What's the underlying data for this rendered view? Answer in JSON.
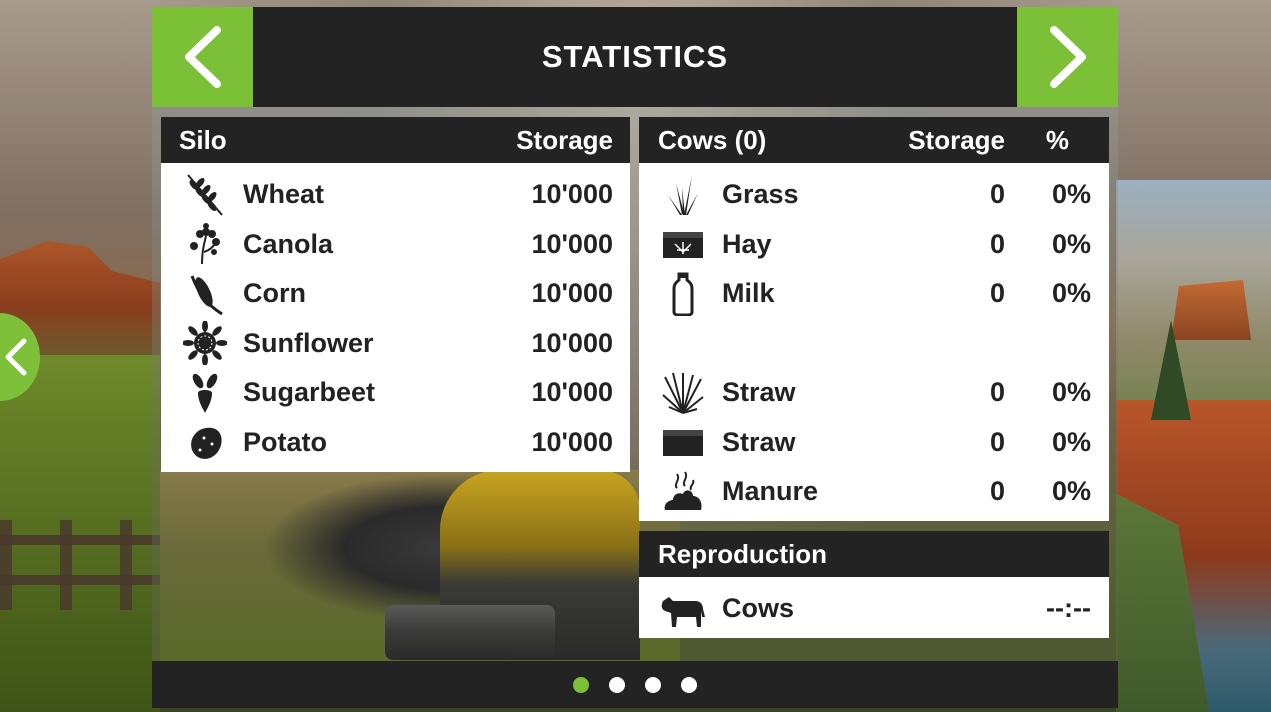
{
  "header": {
    "title": "STATISTICS"
  },
  "silo": {
    "headers": {
      "name": "Silo",
      "storage": "Storage"
    },
    "rows": [
      {
        "icon": "wheat-icon",
        "name": "Wheat",
        "storage": "10'000"
      },
      {
        "icon": "canola-icon",
        "name": "Canola",
        "storage": "10'000"
      },
      {
        "icon": "corn-icon",
        "name": "Corn",
        "storage": "10'000"
      },
      {
        "icon": "sunflower-icon",
        "name": "Sunflower",
        "storage": "10'000"
      },
      {
        "icon": "sugarbeet-icon",
        "name": "Sugarbeet",
        "storage": "10'000"
      },
      {
        "icon": "potato-icon",
        "name": "Potato",
        "storage": "10'000"
      }
    ]
  },
  "cows": {
    "headers": {
      "name": "Cows (0)",
      "storage": "Storage",
      "percent": "%"
    },
    "rows": [
      {
        "icon": "grass-icon",
        "name": "Grass",
        "storage": "0",
        "percent": "0%"
      },
      {
        "icon": "hay-icon",
        "name": "Hay",
        "storage": "0",
        "percent": "0%"
      },
      {
        "icon": "milk-icon",
        "name": "Milk",
        "storage": "0",
        "percent": "0%"
      },
      {
        "icon": "straw-icon",
        "name": "Straw",
        "storage": "0",
        "percent": "0%"
      },
      {
        "icon": "straw-bale-icon",
        "name": "Straw",
        "storage": "0",
        "percent": "0%"
      },
      {
        "icon": "manure-icon",
        "name": "Manure",
        "storage": "0",
        "percent": "0%"
      }
    ]
  },
  "reproduction": {
    "header": "Reproduction",
    "rows": [
      {
        "icon": "cow-icon",
        "name": "Cows",
        "value": "--:--"
      }
    ]
  },
  "pagination": {
    "total": 4,
    "active": 1
  },
  "colors": {
    "accent": "#7cc037",
    "dark": "#232323",
    "panel": "#ffffff"
  }
}
